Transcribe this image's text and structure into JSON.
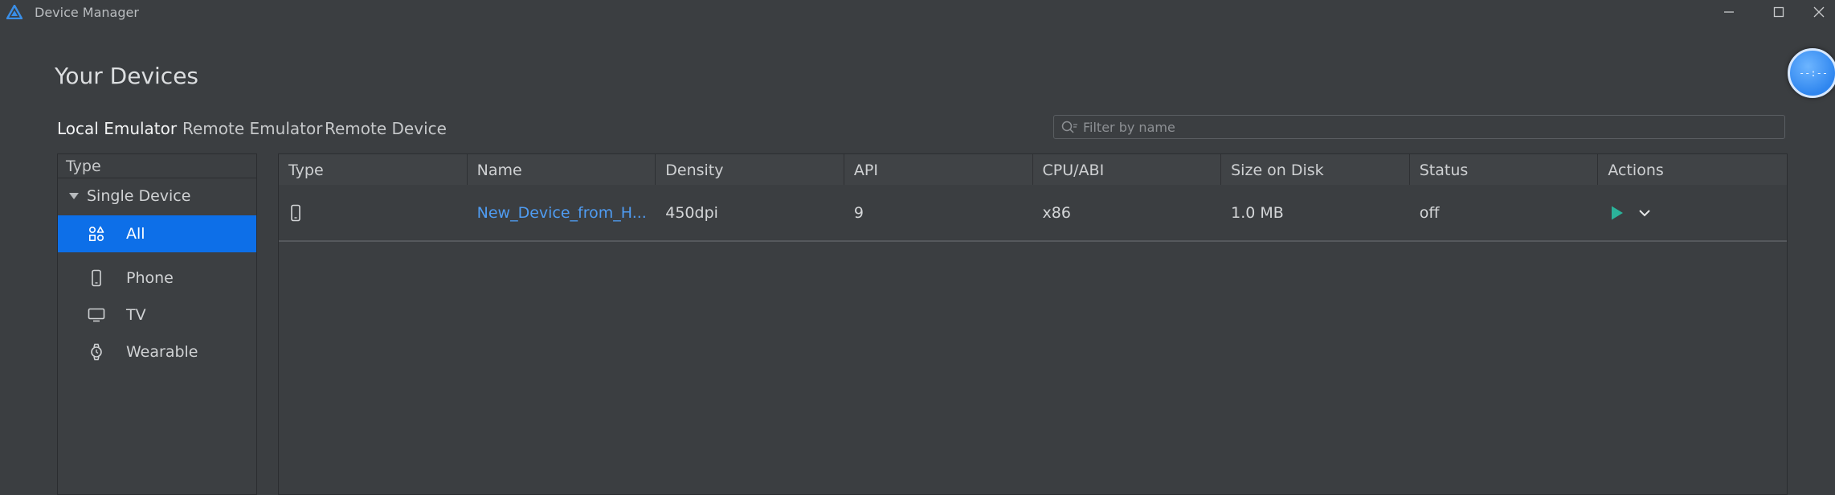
{
  "window": {
    "title": "Device Manager"
  },
  "page": {
    "title": "Your Devices"
  },
  "tabs": [
    {
      "label": "Local Emulator",
      "active": true
    },
    {
      "label": "Remote Emulator",
      "active": false
    },
    {
      "label": "Remote Device",
      "active": false
    }
  ],
  "search": {
    "placeholder": "Filter by name",
    "value": ""
  },
  "float_ball": {
    "text": "--:--"
  },
  "sidebar": {
    "header": "Type",
    "group": "Single Device",
    "items": [
      {
        "label": "All",
        "icon": "grid-shapes-icon",
        "selected": true
      },
      {
        "label": "Phone",
        "icon": "phone-icon",
        "selected": false
      },
      {
        "label": "TV",
        "icon": "tv-icon",
        "selected": false
      },
      {
        "label": "Wearable",
        "icon": "watch-icon",
        "selected": false
      }
    ]
  },
  "table": {
    "columns": [
      "Type",
      "Name",
      "Density",
      "API",
      "CPU/ABI",
      "Size on Disk",
      "Status",
      "Actions"
    ],
    "rows": [
      {
        "type_icon": "phone-icon",
        "name": "New_Device_from_H...",
        "density": "450dpi",
        "api": "9",
        "cpu_abi": "x86",
        "size_on_disk": "1.0 MB",
        "status": "off"
      }
    ]
  },
  "colors": {
    "background": "#3b3e41",
    "accent": "#0d6fe8",
    "link": "#4f9cf2",
    "play": "#2bb39a"
  }
}
